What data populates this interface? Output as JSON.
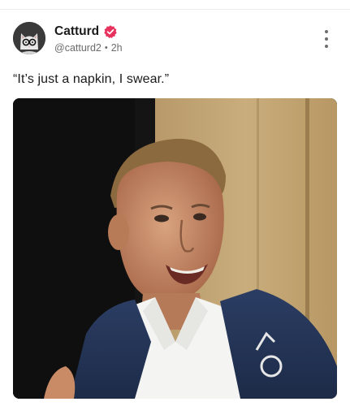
{
  "post": {
    "author": {
      "display_name": "Catturd",
      "handle": "@catturd2",
      "time_ago": "2h",
      "separator": "•",
      "verified_color": "#e8315c",
      "avatar_icon": "cat-with-glasses-avatar"
    },
    "text": "“It’s just a napkin, I swear.”",
    "media": {
      "icon": "photo-of-smiling-man-in-navy-hoodie"
    },
    "menu_icon": "vertical-ellipsis-icon"
  }
}
